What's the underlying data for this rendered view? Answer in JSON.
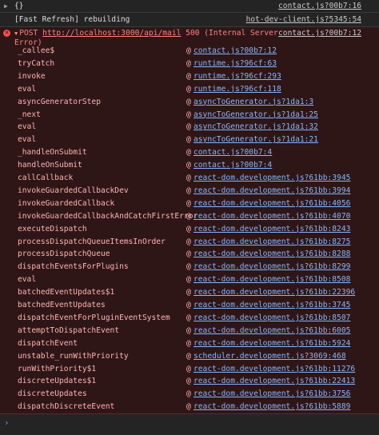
{
  "console": {
    "row1": {
      "object_text": "{}",
      "source": "contact.js?00b7:16"
    },
    "row2": {
      "message": "[Fast Refresh] rebuilding",
      "source": "hot-dev-client.js?5345:54"
    },
    "error": {
      "method": "POST",
      "url": "http://localhost:3000/api/mail",
      "status": "500 (Internal Server Error)",
      "source": "contact.js?00b7:12",
      "stack": [
        {
          "fn": "_callee$",
          "loc": "contact.js?00b7:12"
        },
        {
          "fn": "tryCatch",
          "loc": "runtime.js?96cf:63"
        },
        {
          "fn": "invoke",
          "loc": "runtime.js?96cf:293"
        },
        {
          "fn": "eval",
          "loc": "runtime.js?96cf:118"
        },
        {
          "fn": "asyncGeneratorStep",
          "loc": "asyncToGenerator.js?1da1:3"
        },
        {
          "fn": "_next",
          "loc": "asyncToGenerator.js?1da1:25"
        },
        {
          "fn": "eval",
          "loc": "asyncToGenerator.js?1da1:32"
        },
        {
          "fn": "eval",
          "loc": "asyncToGenerator.js?1da1:21"
        },
        {
          "fn": "_handleOnSubmit",
          "loc": "contact.js?00b7:4"
        },
        {
          "fn": "handleOnSubmit",
          "loc": "contact.js?00b7:4"
        },
        {
          "fn": "callCallback",
          "loc": "react-dom.development.js?61bb:3945"
        },
        {
          "fn": "invokeGuardedCallbackDev",
          "loc": "react-dom.development.js?61bb:3994"
        },
        {
          "fn": "invokeGuardedCallback",
          "loc": "react-dom.development.js?61bb:4056"
        },
        {
          "fn": "invokeGuardedCallbackAndCatchFirstError",
          "loc": "react-dom.development.js?61bb:4070"
        },
        {
          "fn": "executeDispatch",
          "loc": "react-dom.development.js?61bb:8243"
        },
        {
          "fn": "processDispatchQueueItemsInOrder",
          "loc": "react-dom.development.js?61bb:8275"
        },
        {
          "fn": "processDispatchQueue",
          "loc": "react-dom.development.js?61bb:8288"
        },
        {
          "fn": "dispatchEventsForPlugins",
          "loc": "react-dom.development.js?61bb:8299"
        },
        {
          "fn": "eval",
          "loc": "react-dom.development.js?61bb:8508"
        },
        {
          "fn": "batchedEventUpdates$1",
          "loc": "react-dom.development.js?61bb:22396"
        },
        {
          "fn": "batchedEventUpdates",
          "loc": "react-dom.development.js?61bb:3745"
        },
        {
          "fn": "dispatchEventForPluginEventSystem",
          "loc": "react-dom.development.js?61bb:8507"
        },
        {
          "fn": "attemptToDispatchEvent",
          "loc": "react-dom.development.js?61bb:6005"
        },
        {
          "fn": "dispatchEvent",
          "loc": "react-dom.development.js?61bb:5924"
        },
        {
          "fn": "unstable_runWithPriority",
          "loc": "scheduler.development.js?3069:468"
        },
        {
          "fn": "runWithPriority$1",
          "loc": "react-dom.development.js?61bb:11276"
        },
        {
          "fn": "discreteUpdates$1",
          "loc": "react-dom.development.js?61bb:22413"
        },
        {
          "fn": "discreteUpdates",
          "loc": "react-dom.development.js?61bb:3756"
        },
        {
          "fn": "dispatchDiscreteEvent",
          "loc": "react-dom.development.js?61bb:5889"
        }
      ]
    },
    "at_symbol": "@",
    "prompt_symbol": "›"
  }
}
